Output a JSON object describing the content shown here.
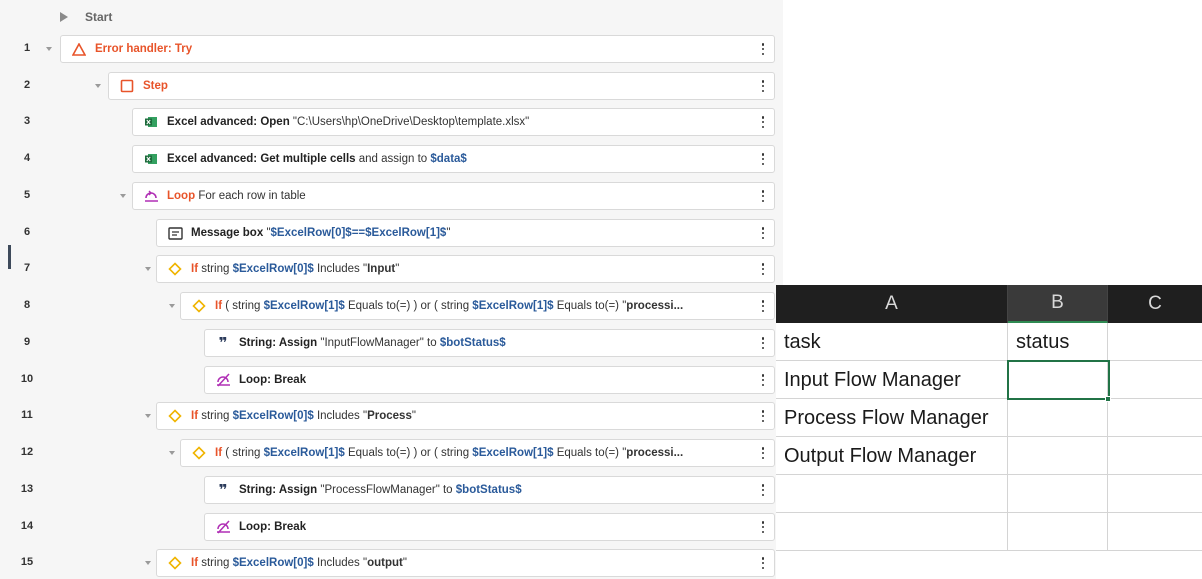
{
  "flow": {
    "start_label": "Start",
    "rows": [
      {
        "n": "1",
        "kw": "Error handler: Try"
      },
      {
        "n": "2",
        "kw": "Step"
      },
      {
        "n": "3",
        "kw": "Excel advanced: Open",
        "rest": "\"C:\\Users\\hp\\OneDrive\\Desktop\\template.xlsx\""
      },
      {
        "n": "4",
        "kw": "Excel advanced: Get multiple cells",
        "mid": "and assign to",
        "var": "$data$"
      },
      {
        "n": "5",
        "kw": "Loop",
        "rest": "For each row in table"
      },
      {
        "n": "6",
        "kw": "Message box",
        "q1": "\"",
        "var": "$ExcelRow[0]$==$ExcelRow[1]$",
        "q2": "\""
      },
      {
        "n": "7",
        "kw": "If",
        "pre": "string",
        "var": "$ExcelRow[0]$",
        "mid": "Includes",
        "lit": "Input"
      },
      {
        "n": "8",
        "kw": "If",
        "p1": "( string",
        "v1": "$ExcelRow[1]$",
        "p2": "Equals to(=) ) or ( string",
        "v2": "$ExcelRow[1]$",
        "p3": "Equals to(=) \"",
        "lit": "processi..."
      },
      {
        "n": "9",
        "kw": "String: Assign",
        "lit": "InputFlowManager",
        "mid": "to",
        "var": "$botStatus$"
      },
      {
        "n": "10",
        "kw": "Loop: Break"
      },
      {
        "n": "11",
        "kw": "If",
        "pre": "string",
        "var": "$ExcelRow[0]$",
        "mid": "Includes",
        "lit": "Process"
      },
      {
        "n": "12",
        "kw": "If",
        "p1": "( string",
        "v1": "$ExcelRow[1]$",
        "p2": "Equals to(=) ) or ( string",
        "v2": "$ExcelRow[1]$",
        "p3": "Equals to(=) \"",
        "lit": "processi..."
      },
      {
        "n": "13",
        "kw": "String: Assign",
        "lit": "ProcessFlowManager",
        "mid": "to",
        "var": "$botStatus$"
      },
      {
        "n": "14",
        "kw": "Loop: Break"
      },
      {
        "n": "15",
        "kw": "If",
        "pre": "string",
        "var": "$ExcelRow[0]$",
        "mid": "Includes",
        "lit": "output"
      }
    ]
  },
  "excel": {
    "columns": [
      "A",
      "B",
      "C"
    ],
    "cells": [
      [
        "task",
        "status",
        ""
      ],
      [
        "Input Flow Manager",
        "",
        ""
      ],
      [
        "Process Flow Manager",
        "",
        ""
      ],
      [
        "Output Flow Manager",
        "",
        ""
      ],
      [
        "",
        "",
        ""
      ],
      [
        "",
        "",
        ""
      ]
    ],
    "colors": {
      "header_bg": "#1f1f1f",
      "selection": "#217346"
    }
  }
}
